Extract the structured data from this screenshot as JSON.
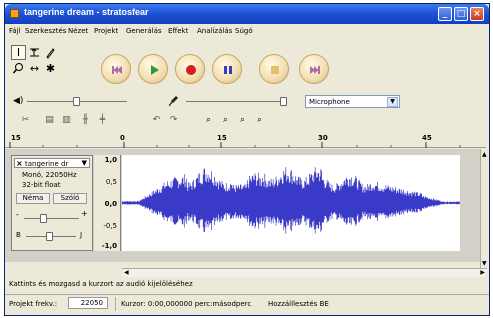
{
  "window": {
    "title": "tangerine dream - stratosfear"
  },
  "menu": [
    "Fájl",
    "Szerkesztés",
    "Nézet",
    "Projekt",
    "Generálás",
    "Effekt",
    "Analízálás",
    "Súgó"
  ],
  "tools": [
    "selection-tool",
    "envelope-tool",
    "draw-tool",
    "zoom-tool",
    "timeshift-tool",
    "multi-tool"
  ],
  "transport": [
    "skip-to-start",
    "play",
    "record",
    "pause",
    "stop",
    "skip-to-end"
  ],
  "mixer": {
    "input_source": "Microphone"
  },
  "ruler": {
    "labels": [
      "15",
      "0",
      "15",
      "30",
      "45"
    ]
  },
  "track": {
    "name": "tangerine dr",
    "format_line1": "Monó, 22050Hz",
    "format_line2": "32-bit float",
    "mute_label": "Néma",
    "solo_label": "Szóló",
    "pan_left": "B",
    "pan_right": "J",
    "gain_minus": "-",
    "gain_plus": "+",
    "scale": [
      "1,0",
      "0,5",
      "0,0",
      "-0,5",
      "-1,0"
    ]
  },
  "status": {
    "hint": "Kattints és mozgasd a kurzort az audió kijelöléséhez",
    "project_rate_label": "Projekt frekv.:",
    "project_rate": "22050",
    "cursor": "Kurzor: 0:00,000000 perc:másodperc",
    "snap": "Hozzáillesztés BE"
  },
  "colors": {
    "waveform": "#3a3ac8",
    "titlebar": "#1f54d6"
  }
}
